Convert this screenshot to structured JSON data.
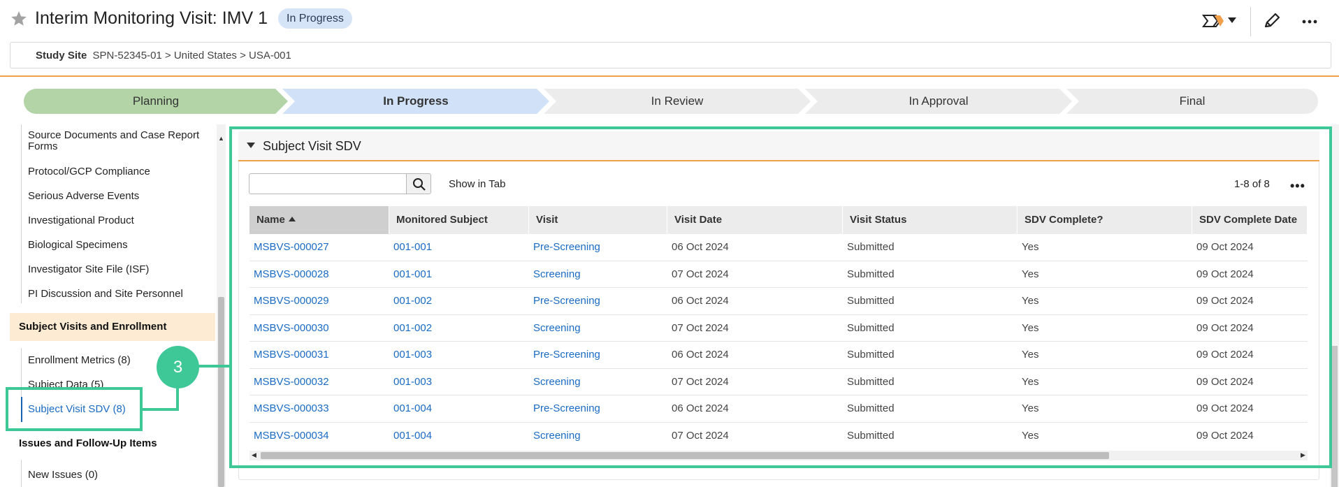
{
  "header": {
    "title": "Interim Monitoring Visit: IMV 1",
    "status_badge": "In Progress",
    "icons": [
      "star-icon",
      "workflow-icon",
      "chevron-down-icon",
      "pencil-icon",
      "more-icon"
    ]
  },
  "breadcrumb": {
    "label": "Study Site",
    "path": "SPN-52345-01 > United States > USA-001"
  },
  "stages": [
    {
      "label": "Planning",
      "state": "complete",
      "color": "#b2d4a6"
    },
    {
      "label": "In Progress",
      "state": "current",
      "color": "#d1e2f8"
    },
    {
      "label": "In Review",
      "state": "pending",
      "color": "#ececec"
    },
    {
      "label": "In Approval",
      "state": "pending",
      "color": "#ececec"
    },
    {
      "label": "Final",
      "state": "pending",
      "color": "#ececec"
    }
  ],
  "sidebar": {
    "items_top": [
      "Source Documents and Case Report Forms",
      "Protocol/GCP Compliance",
      "Serious Adverse Events",
      "Investigational Product",
      "Biological Specimens",
      "Investigator Site File (ISF)",
      "PI Discussion and Site Personnel"
    ],
    "section_active": "Subject Visits and Enrollment",
    "items_section": [
      "Enrollment Metrics (8)",
      "Subject Data (5)",
      "Subject Visit SDV (8)"
    ],
    "section_next": "Issues and Follow-Up Items",
    "items_next": [
      "New Issues (0)"
    ]
  },
  "panel": {
    "title": "Subject Visit SDV",
    "search_placeholder": "",
    "show_in_tab": "Show in Tab",
    "count": "1-8 of 8",
    "columns": [
      "Name",
      "Monitored Subject",
      "Visit",
      "Visit Date",
      "Visit Status",
      "SDV Complete?",
      "SDV Complete Date"
    ],
    "rows": [
      [
        "MSBVS-000027",
        "001-001",
        "Pre-Screening",
        "06 Oct 2024",
        "Submitted",
        "Yes",
        "09 Oct 2024"
      ],
      [
        "MSBVS-000028",
        "001-001",
        "Screening",
        "07 Oct 2024",
        "Submitted",
        "Yes",
        "09 Oct 2024"
      ],
      [
        "MSBVS-000029",
        "001-002",
        "Pre-Screening",
        "06 Oct 2024",
        "Submitted",
        "Yes",
        "09 Oct 2024"
      ],
      [
        "MSBVS-000030",
        "001-002",
        "Screening",
        "07 Oct 2024",
        "Submitted",
        "Yes",
        "09 Oct 2024"
      ],
      [
        "MSBVS-000031",
        "001-003",
        "Pre-Screening",
        "06 Oct 2024",
        "Submitted",
        "Yes",
        "09 Oct 2024"
      ],
      [
        "MSBVS-000032",
        "001-003",
        "Screening",
        "07 Oct 2024",
        "Submitted",
        "Yes",
        "09 Oct 2024"
      ],
      [
        "MSBVS-000033",
        "001-004",
        "Pre-Screening",
        "06 Oct 2024",
        "Submitted",
        "Yes",
        "09 Oct 2024"
      ],
      [
        "MSBVS-000034",
        "001-004",
        "Screening",
        "07 Oct 2024",
        "Submitted",
        "Yes",
        "09 Oct 2024"
      ]
    ]
  },
  "annotation": {
    "label": "3",
    "color": "#3ec797"
  }
}
